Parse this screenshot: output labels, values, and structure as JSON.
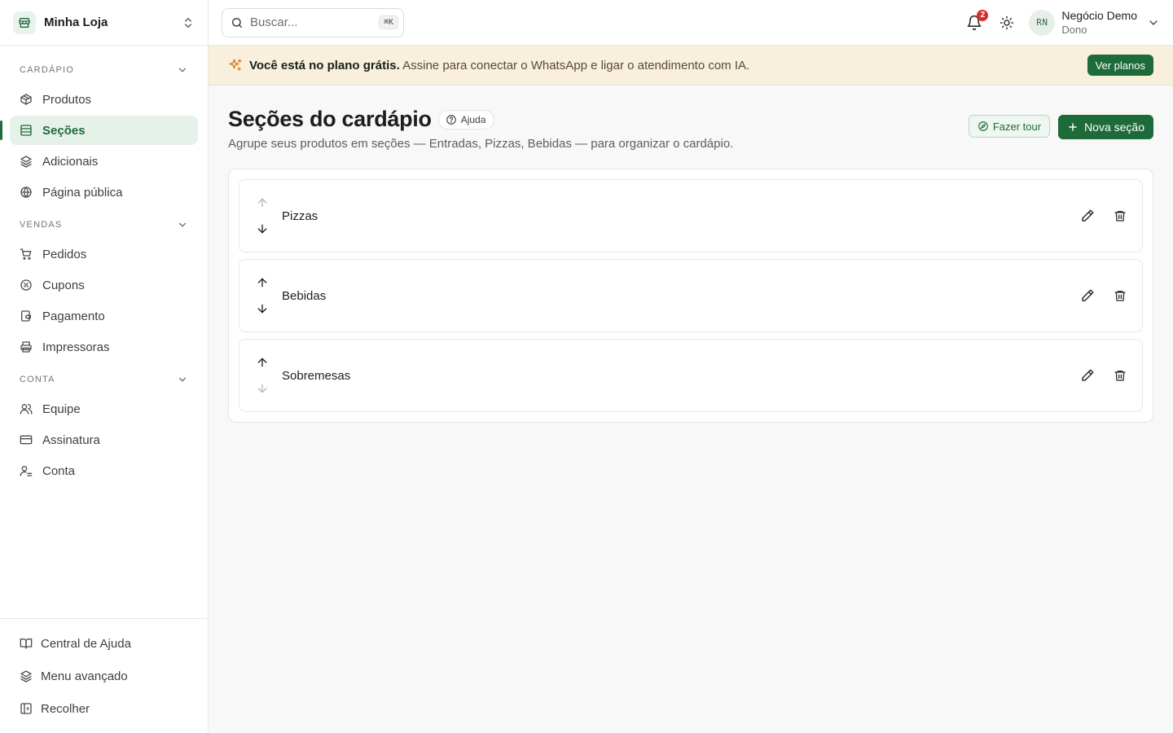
{
  "store": {
    "name": "Minha Loja"
  },
  "sidebar": {
    "groups": [
      {
        "label": "CARDÁPIO",
        "items": [
          {
            "label": "Produtos",
            "icon": "box-icon"
          },
          {
            "label": "Seções",
            "icon": "list-icon",
            "active": true
          },
          {
            "label": "Adicionais",
            "icon": "layers-icon"
          },
          {
            "label": "Página pública",
            "icon": "globe-icon"
          }
        ]
      },
      {
        "label": "VENDAS",
        "items": [
          {
            "label": "Pedidos",
            "icon": "cart-icon"
          },
          {
            "label": "Cupons",
            "icon": "coupon-icon"
          },
          {
            "label": "Pagamento",
            "icon": "wallet-icon"
          },
          {
            "label": "Impressoras",
            "icon": "printer-icon"
          }
        ]
      },
      {
        "label": "CONTA",
        "items": [
          {
            "label": "Equipe",
            "icon": "users-icon"
          },
          {
            "label": "Assinatura",
            "icon": "credit-card-icon"
          },
          {
            "label": "Conta",
            "icon": "user-cog-icon"
          }
        ]
      }
    ],
    "footer": [
      {
        "label": "Central de Ajuda",
        "icon": "book-icon"
      },
      {
        "label": "Menu avançado",
        "icon": "layers-icon"
      },
      {
        "label": "Recolher",
        "icon": "collapse-icon"
      }
    ]
  },
  "topbar": {
    "search_placeholder": "Buscar...",
    "search_shortcut": "⌘K",
    "notifications_count": "2",
    "user": {
      "initials": "RN",
      "name": "Negócio Demo",
      "role": "Dono"
    }
  },
  "banner": {
    "strong": "Você está no plano grátis.",
    "text": "Assine para conectar o WhatsApp e ligar o atendimento com IA.",
    "button": "Ver planos"
  },
  "page": {
    "title": "Seções do cardápio",
    "help_label": "Ajuda",
    "subtitle": "Agrupe seus produtos em seções — Entradas, Pizzas, Bebidas — para organizar o cardápio.",
    "tour_label": "Fazer tour",
    "new_label": "Nova seção"
  },
  "sections": [
    {
      "name": "Pizzas",
      "up_enabled": false,
      "down_enabled": true
    },
    {
      "name": "Bebidas",
      "up_enabled": true,
      "down_enabled": true
    },
    {
      "name": "Sobremesas",
      "up_enabled": true,
      "down_enabled": false
    }
  ],
  "colors": {
    "accent": "#1e6b3a",
    "banner_bg": "#f8efdc",
    "badge": "#d92d2d"
  }
}
